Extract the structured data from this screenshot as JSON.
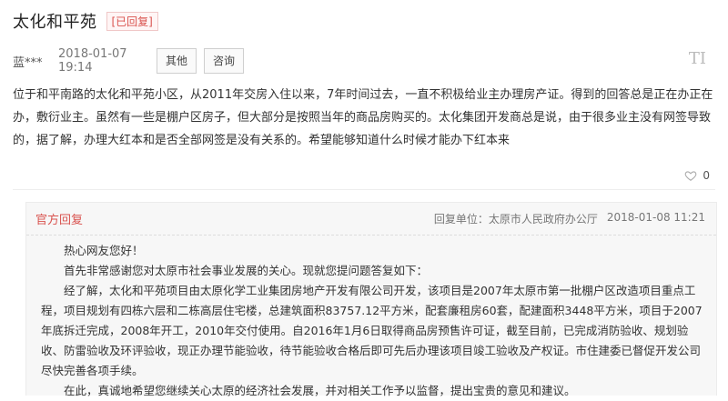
{
  "header": {
    "title": "太化和平苑",
    "status_badge": "[已回复]"
  },
  "question": {
    "user": "蓝***",
    "time": "2018-01-07 19:14",
    "buttons": {
      "other": "其他",
      "consult": "咨询"
    },
    "font_icon": "TI",
    "content": "位于和平南路的太化和平苑小区，从2011年交房入住以来，7年时间过去，一直不积极给业主办理房产证。得到的回答总是正在办正在办，敷衍业主。虽然有一些是棚户区房子，但大部分是按照当年的商品房购买的。太化集团开发商总是说，由于很多业主没有网签导致的，据了解，办理大红本和是否全部网签是没有关系的。希望能够知道什么时候才能办下红本来",
    "likes": "0",
    "like_icon": "heart-icon"
  },
  "reply": {
    "label": "官方回复",
    "unit": "回复单位：太原市人民政府办公厅",
    "time": "2018-01-08 11:21",
    "paragraphs": [
      "热心网友您好！",
      "首先非常感谢您对太原市社会事业发展的关心。现就您提问题答复如下：",
      "经了解，太化和平苑项目由太原化学工业集团房地产开发有限公司开发，该项目是2007年太原市第一批棚户区改造项目重点工程，项目规划有四栋六层和二栋高层住宅楼，总建筑面积83757.12平方米，配套廉租房60套，配建面积3448平方米，项目于2007年底拆迁完成，2008年开工，2010年交付使用。自2016年1月6日取得商品房预售许可证，截至目前，已完成消防验收、规划验收、防雷验收及环评验收，现正办理节能验收，待节能验收合格后即可先后办理该项目竣工验收及产权证。市住建委已督促开发公司尽快完善各项手续。",
      "在此，真诚地希望您继续关心太原的经济社会发展，并对相关工作予以监督，提出宝贵的意见和建议。"
    ]
  }
}
